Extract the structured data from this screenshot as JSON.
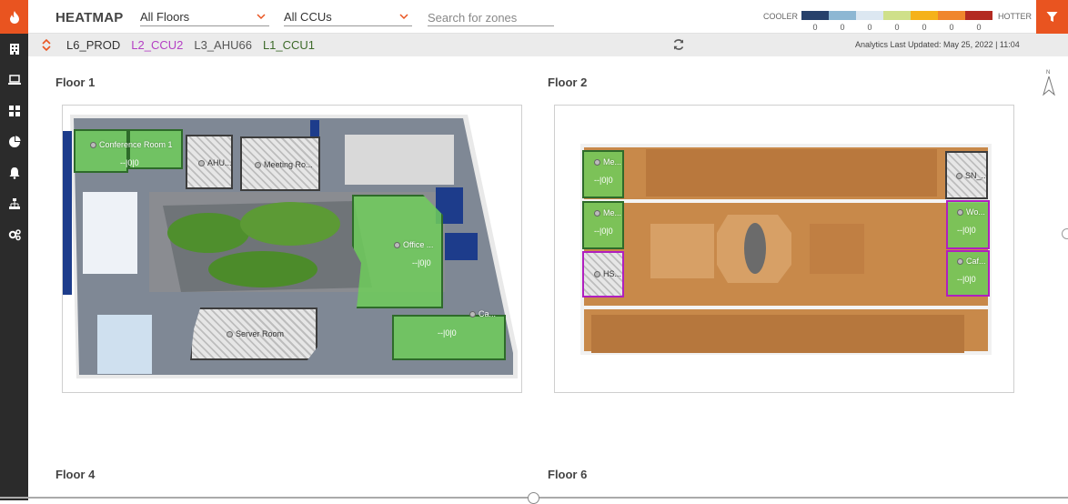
{
  "header": {
    "title": "HEATMAP",
    "floors_dropdown": "All Floors",
    "ccus_dropdown": "All CCUs",
    "search_placeholder": "Search for zones"
  },
  "legend": {
    "cooler_label": "COOLER",
    "hotter_label": "HOTTER",
    "colors": [
      "#27416b",
      "#8db7d3",
      "#dce7f1",
      "#cfe08a",
      "#f5b21a",
      "#f0862c",
      "#b32a22"
    ],
    "counts": [
      "0",
      "0",
      "0",
      "0",
      "0",
      "0",
      "0"
    ]
  },
  "subbar": {
    "crumbs": [
      {
        "label": "L6_PROD",
        "color": "#333333"
      },
      {
        "label": "L2_CCU2",
        "color": "#b43fc4"
      },
      {
        "label": "L3_AHU66",
        "color": "#555555"
      },
      {
        "label": "L1_CCU1",
        "color": "#3d6a2a"
      }
    ],
    "updated": "Analytics Last Updated: May 25, 2022 | 11:04"
  },
  "floors": {
    "floor1": {
      "title": "Floor 1",
      "zones": [
        {
          "name": "Conference Room 1",
          "value": "--|0|0"
        },
        {
          "name": "AHU...",
          "value": ""
        },
        {
          "name": "Meeting Ro...",
          "value": ""
        },
        {
          "name": "Office ...",
          "value": "--|0|0"
        },
        {
          "name": "Server Room",
          "value": ""
        },
        {
          "name": "Ca...",
          "value": "--|0|0"
        }
      ]
    },
    "floor2": {
      "title": "Floor 2",
      "zones": [
        {
          "name": "Me...",
          "value": "--|0|0"
        },
        {
          "name": "Me...",
          "value": "--|0|0"
        },
        {
          "name": "HS...",
          "value": ""
        },
        {
          "name": "SN_...",
          "value": ""
        },
        {
          "name": "Wo...",
          "value": "--|0|0"
        },
        {
          "name": "Caf...",
          "value": "--|0|0"
        }
      ]
    },
    "floor4": {
      "title": "Floor 4"
    },
    "floor6": {
      "title": "Floor 6"
    }
  },
  "compass": {
    "label": "N"
  }
}
